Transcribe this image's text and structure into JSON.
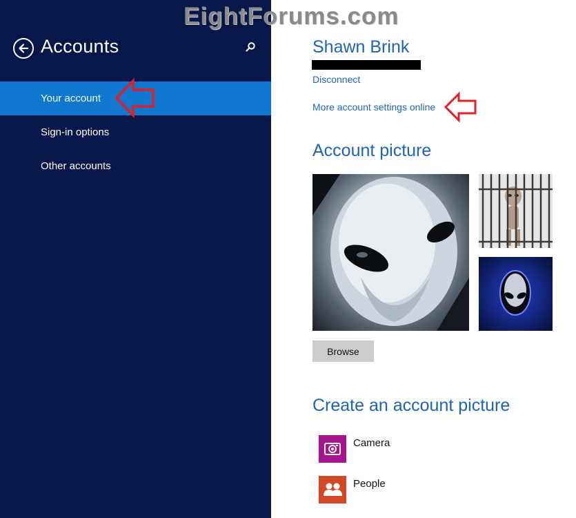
{
  "watermark": "EightForums.com",
  "sidebar": {
    "title": "Accounts",
    "items": [
      {
        "label": "Your account",
        "active": true
      },
      {
        "label": "Sign-in options",
        "active": false
      },
      {
        "label": "Other accounts",
        "active": false
      }
    ]
  },
  "account": {
    "name": "Shawn Brink",
    "disconnect_label": "Disconnect",
    "more_settings_label": "More account settings online"
  },
  "account_picture": {
    "title": "Account picture",
    "browse_label": "Browse"
  },
  "create_picture": {
    "title": "Create an account picture",
    "apps": [
      {
        "label": "Camera",
        "icon": "camera-icon",
        "color": "#a4168e"
      },
      {
        "label": "People",
        "icon": "people-icon",
        "color": "#d24726"
      }
    ]
  },
  "colors": {
    "sidebar_bg": "#08174a",
    "selected_bg": "#0f77d0",
    "link": "#1c64b5",
    "annotation_arrow": "#e01f26"
  }
}
